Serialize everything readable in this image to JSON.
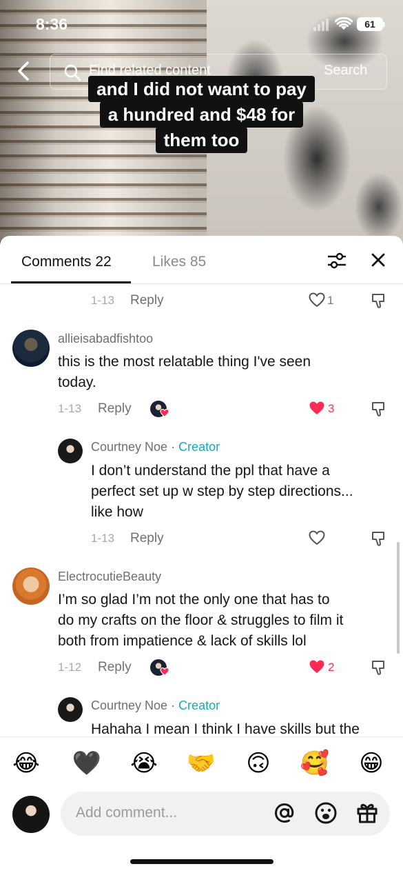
{
  "status_bar": {
    "time": "8:36",
    "battery": "61"
  },
  "search": {
    "placeholder": "Find related content",
    "button": "Search"
  },
  "caption": {
    "lines": [
      "and I did not want to pay",
      "a hundred and $48 for",
      "them too"
    ]
  },
  "tabs": {
    "comments": "Comments 22",
    "likes": "Likes 85"
  },
  "comments": [
    {
      "date": "1-13",
      "reply": "Reply",
      "likes": "1",
      "liked": false
    },
    {
      "username": "allieisabadfishtoo",
      "text_lines": [
        "this is the most relatable thing I've seen",
        "today."
      ],
      "date": "1-13",
      "reply": "Reply",
      "likes": "3",
      "liked": true
    },
    {
      "username": "Courtney Noe",
      "creator_sep": " · ",
      "creator_label": "Creator",
      "text_lines": [
        "I don’t understand the ppl that have a",
        "perfect set up w step by step directions...",
        "like how"
      ],
      "date": "1-13",
      "reply": "Reply",
      "liked": false
    },
    {
      "username": "ElectrocutieBeauty",
      "text_lines": [
        "I’m so glad I’m not the only one that has to",
        "do my crafts on the floor & struggles to film it",
        "both from impatience & lack of skills lol"
      ],
      "date": "1-12",
      "reply": "Reply",
      "likes": "2",
      "liked": true
    },
    {
      "username": "Courtney Noe",
      "creator_sep": " · ",
      "creator_label": "Creator",
      "text_lines": [
        "Hahaha I mean I think I have skills but the"
      ]
    }
  ],
  "emojis": [
    "😂",
    "🖤",
    "😭",
    "🤝",
    "🙃",
    "🥰",
    "😁"
  ],
  "input": {
    "placeholder": "Add comment..."
  },
  "colors": {
    "like_red": "#fe2c55",
    "creator": "#19a7c4"
  }
}
